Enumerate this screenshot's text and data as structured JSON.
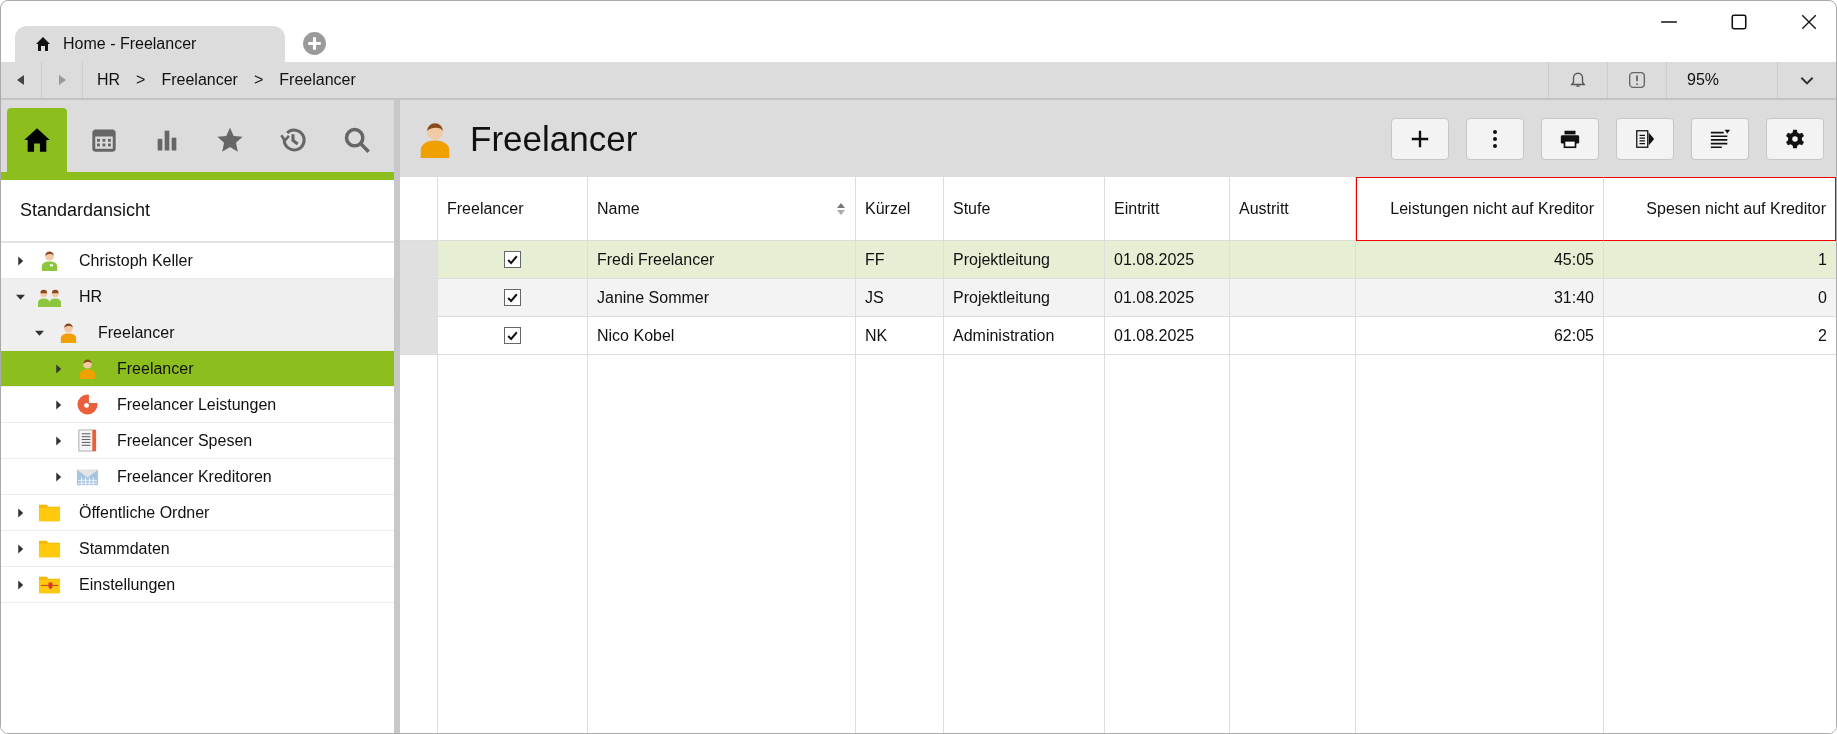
{
  "tab": {
    "title": "Home - Freelancer"
  },
  "breadcrumb": {
    "items": [
      "HR",
      "Freelancer",
      "Freelancer"
    ],
    "separator": ">"
  },
  "status": {
    "zoom": "95%"
  },
  "sidebar": {
    "tabs": [
      {
        "kind": "home",
        "selected": true
      },
      {
        "kind": "calendar",
        "selected": false
      },
      {
        "kind": "chart",
        "selected": false
      },
      {
        "kind": "star",
        "selected": false
      },
      {
        "kind": "history",
        "selected": false
      },
      {
        "kind": "search",
        "selected": false
      }
    ],
    "view_title": "Standardansicht",
    "tree": [
      {
        "label": "Christoph Keller",
        "kind": "user",
        "expanded": false,
        "selected": false
      },
      {
        "label": "HR",
        "kind": "group",
        "expanded": true,
        "selected": false,
        "children": [
          {
            "label": "Freelancer",
            "kind": "role",
            "expanded": true,
            "selected": false,
            "children": [
              {
                "label": "Freelancer",
                "kind": "role",
                "expanded": false,
                "selected": true
              },
              {
                "label": "Freelancer Leistungen",
                "kind": "pie",
                "expanded": false,
                "selected": false
              },
              {
                "label": "Freelancer Spesen",
                "kind": "list",
                "expanded": false,
                "selected": false
              },
              {
                "label": "Freelancer Kreditoren",
                "kind": "mail",
                "expanded": false,
                "selected": false
              }
            ]
          }
        ]
      },
      {
        "label": "Öffentliche Ordner",
        "kind": "folder",
        "expanded": false,
        "selected": false
      },
      {
        "label": "Stammdaten",
        "kind": "folder",
        "expanded": false,
        "selected": false
      },
      {
        "label": "Einstellungen",
        "kind": "settings-folder",
        "expanded": false,
        "selected": false
      }
    ]
  },
  "main": {
    "title": "Freelancer",
    "toolbar": [
      {
        "kind": "add"
      },
      {
        "kind": "more"
      },
      {
        "kind": "print"
      },
      {
        "kind": "export"
      },
      {
        "kind": "list"
      },
      {
        "kind": "settings"
      }
    ]
  },
  "table": {
    "columns": [
      {
        "label": "Freelancer",
        "kind": "checkbox",
        "sortable": false,
        "highlighted": false
      },
      {
        "label": "Name",
        "kind": "text",
        "sortable": true,
        "highlighted": false
      },
      {
        "label": "Kürzel",
        "kind": "text",
        "sortable": false,
        "highlighted": false
      },
      {
        "label": "Stufe",
        "kind": "text",
        "sortable": false,
        "highlighted": false
      },
      {
        "label": "Eintritt",
        "kind": "text",
        "sortable": false,
        "highlighted": false
      },
      {
        "label": "Austritt",
        "kind": "text",
        "sortable": false,
        "highlighted": false
      },
      {
        "label": "Leistungen nicht auf Kreditor",
        "kind": "number",
        "sortable": false,
        "highlighted": true
      },
      {
        "label": "Spesen nicht auf Kreditor",
        "kind": "number",
        "sortable": false,
        "highlighted": true
      }
    ],
    "rows": [
      {
        "selected": true,
        "hovered": false,
        "cells": [
          {
            "checked": true
          },
          "Fredi Freelancer",
          "FF",
          "Projektleitung",
          "01.08.2025",
          "",
          "45:05",
          "1"
        ]
      },
      {
        "selected": false,
        "hovered": true,
        "cells": [
          {
            "checked": true
          },
          "Janine Sommer",
          "JS",
          "Projektleitung",
          "01.08.2025",
          "",
          "31:40",
          "0"
        ]
      },
      {
        "selected": false,
        "hovered": false,
        "cells": [
          {
            "checked": true
          },
          "Nico Kobel",
          "NK",
          "Administration",
          "01.08.2025",
          "",
          "62:05",
          "2"
        ]
      }
    ]
  }
}
